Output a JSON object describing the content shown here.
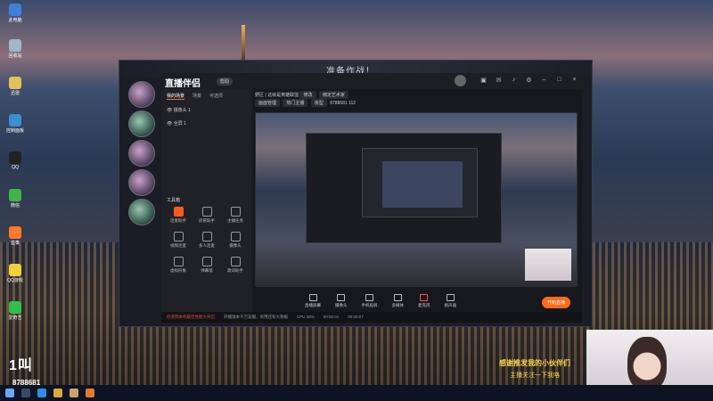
{
  "game": {
    "title": "准备作战！"
  },
  "app": {
    "logo": "直播伴侣",
    "badge": "帮助",
    "tabs": [
      "我的场景",
      "场景",
      "可选项"
    ],
    "scenes": [
      "摄像头 1",
      "全屏 1"
    ],
    "tools_title": "工具箱",
    "tools": [
      {
        "label": "连麦助手",
        "hot": true
      },
      {
        "label": "房管助手",
        "hot": false
      },
      {
        "label": "主播任务",
        "hot": false
      },
      {
        "label": "视频连麦",
        "hot": false
      },
      {
        "label": "多人连麦",
        "hot": false
      },
      {
        "label": "摄像头",
        "hot": false
      },
      {
        "label": "虚拟形象",
        "hot": false
      },
      {
        "label": "弹幕墙",
        "hot": false
      },
      {
        "label": "歌词助手",
        "hot": false
      }
    ],
    "preview_head": {
      "title": "野区 | 这就是英雄联盟",
      "pills": [
        "修改",
        "绑定艺术家",
        "画面管理",
        "热门主播",
        "房型",
        "8788681"
      ],
      "count": "112"
    },
    "bottom": [
      {
        "label": "直播屏幕",
        "icon": "screen-icon"
      },
      {
        "label": "摄像头",
        "icon": "camera-icon"
      },
      {
        "label": "手机投屏",
        "icon": "phone-icon"
      },
      {
        "label": "多媒体",
        "icon": "media-icon"
      },
      {
        "label": "麦克风",
        "icon": "mic-icon"
      },
      {
        "label": "扬声器",
        "icon": "speaker-icon"
      }
    ],
    "start_label": "开始直播",
    "status": {
      "warn": "检测到本机最佳性能大开启",
      "msg": "开播请本千万美摄，有用还有大救援",
      "cpu": "CPU 33%",
      "time1": "00:00:01",
      "time2": "00:00:07"
    }
  },
  "overlay": {
    "room_logo": "1叫",
    "room_id": "8788681",
    "follow_line1": "感谢推发我的小伙伴们",
    "follow_line2": "主播关注一下我咯"
  },
  "desktop_icons": [
    "此电脑",
    "回收站",
    "迅雷",
    "控制面板",
    "QQ",
    "微信",
    "蓝奏",
    "QQ游戏",
    "爱奇艺"
  ]
}
